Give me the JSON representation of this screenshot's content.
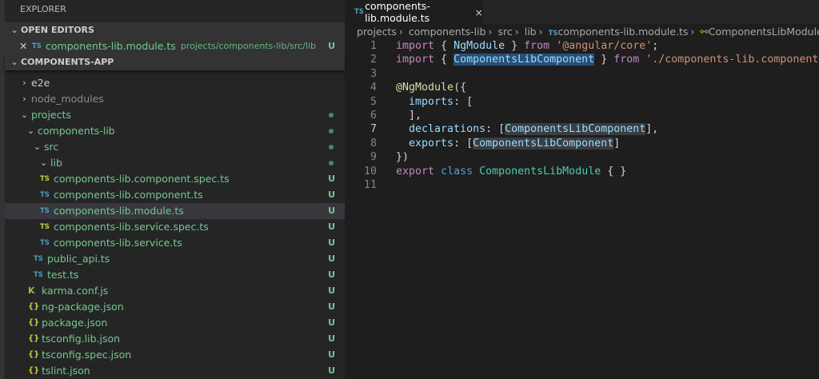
{
  "sidebar": {
    "title": "EXPLORER",
    "open_editors": {
      "label": "OPEN EDITORS",
      "item": {
        "name": "components-lib.module.ts",
        "path": "projects/components-lib/src/lib",
        "status": "U",
        "icon": "TS"
      }
    },
    "project": {
      "label": "COMPONENTS-APP"
    },
    "tree": [
      {
        "name": "e2e",
        "type": "folder",
        "open": false,
        "status": ""
      },
      {
        "name": "node_modules",
        "type": "folder",
        "open": false,
        "status": ""
      },
      {
        "name": "projects",
        "type": "folder",
        "open": true,
        "status": "dot"
      },
      {
        "name": "components-lib",
        "type": "folder",
        "open": true,
        "status": "dot"
      },
      {
        "name": "src",
        "type": "folder",
        "open": true,
        "status": "dot"
      },
      {
        "name": "lib",
        "type": "folder",
        "open": true,
        "status": "dot"
      },
      {
        "name": "components-lib.component.spec.ts",
        "icon": "TS",
        "status": "U"
      },
      {
        "name": "components-lib.component.ts",
        "icon": "TS",
        "status": "U"
      },
      {
        "name": "components-lib.module.ts",
        "icon": "TS",
        "status": "U",
        "selected": true
      },
      {
        "name": "components-lib.service.spec.ts",
        "icon": "TS",
        "status": "U"
      },
      {
        "name": "components-lib.service.ts",
        "icon": "TS",
        "status": "U"
      },
      {
        "name": "public_api.ts",
        "icon": "TS",
        "status": "U"
      },
      {
        "name": "test.ts",
        "icon": "TS",
        "status": "U"
      },
      {
        "name": "karma.conf.js",
        "icon": "K",
        "status": "U"
      },
      {
        "name": "ng-package.json",
        "icon": "{}",
        "status": "U"
      },
      {
        "name": "package.json",
        "icon": "{}",
        "status": "U"
      },
      {
        "name": "tsconfig.lib.json",
        "icon": "{}",
        "status": "U"
      },
      {
        "name": "tsconfig.spec.json",
        "icon": "{}",
        "status": "U"
      },
      {
        "name": "tslint.json",
        "icon": "{}",
        "status": "U"
      }
    ]
  },
  "editor": {
    "tab": {
      "icon": "TS",
      "label": "components-lib.module.ts",
      "close": "×"
    },
    "breadcrumb": [
      "projects",
      "components-lib",
      "src",
      "lib",
      "components-lib.module.ts",
      "ComponentsLibModule"
    ],
    "breadcrumb_ts": "TS",
    "line_numbers": [
      "1",
      "2",
      "3",
      "4",
      "5",
      "6",
      "7",
      "8",
      "9",
      "10",
      "11"
    ],
    "code": {
      "l1": [
        "import",
        " { ",
        "NgModule",
        " } ",
        "from",
        " ",
        "'@angular/core'",
        ";"
      ],
      "l2": [
        "import",
        " { ",
        "ComponentsLibComponent",
        " } ",
        "from",
        " ",
        "'./components-lib.component'",
        ";"
      ],
      "l4": [
        "@NgModule",
        "({"
      ],
      "l5": [
        "  ",
        "imports",
        ": ["
      ],
      "l6": [
        "  ],"
      ],
      "l7": [
        "  ",
        "declarations",
        ": [",
        "ComponentsLibComponent",
        "],"
      ],
      "l8": [
        "  ",
        "exports",
        ": [",
        "ComponentsLibComponent",
        "]"
      ],
      "l9": [
        "})"
      ],
      "l10": [
        "export",
        " ",
        "class",
        " ",
        "ComponentsLibModule",
        " { }"
      ]
    }
  }
}
